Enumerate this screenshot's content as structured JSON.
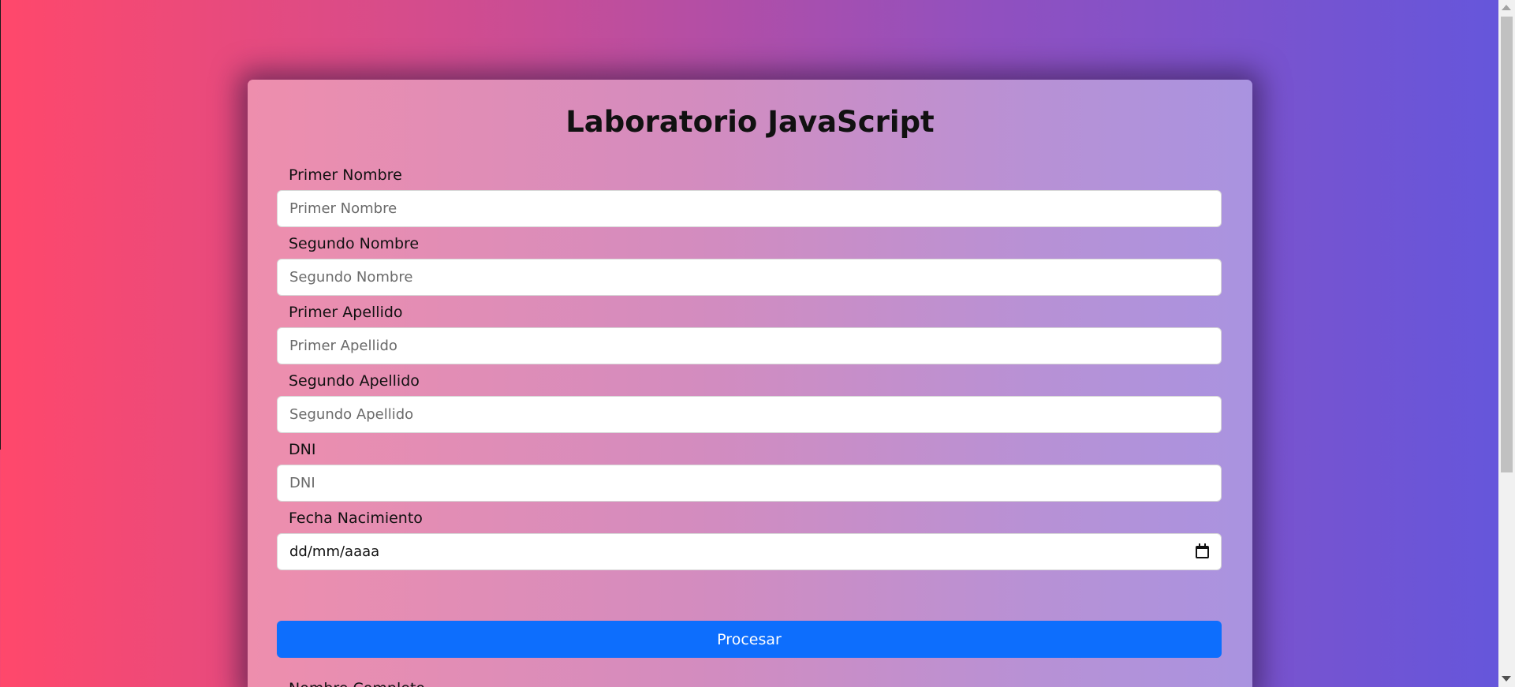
{
  "page": {
    "title": "Laboratorio JavaScript"
  },
  "form": {
    "fields": [
      {
        "label": "Primer Nombre",
        "placeholder": "Primer Nombre",
        "value": ""
      },
      {
        "label": "Segundo Nombre",
        "placeholder": "Segundo Nombre",
        "value": ""
      },
      {
        "label": "Primer Apellido",
        "placeholder": "Primer Apellido",
        "value": ""
      },
      {
        "label": "Segundo Apellido",
        "placeholder": "Segundo Apellido",
        "value": ""
      },
      {
        "label": "DNI",
        "placeholder": "DNI",
        "value": ""
      },
      {
        "label": "Fecha Nacimiento",
        "display_value": "dd/mm/aaaa"
      }
    ],
    "submit_label": "Procesar",
    "result_label": "Nombre Completo"
  },
  "colors": {
    "background_gradient_start": "#ff486b",
    "background_gradient_end": "#6456dc",
    "card_gradient_start": "#ee8ead",
    "card_gradient_end": "#a993e0",
    "button": "#0d6efd",
    "button_text": "#ffffff"
  },
  "icons": {
    "date_picker": "calendar-icon"
  }
}
